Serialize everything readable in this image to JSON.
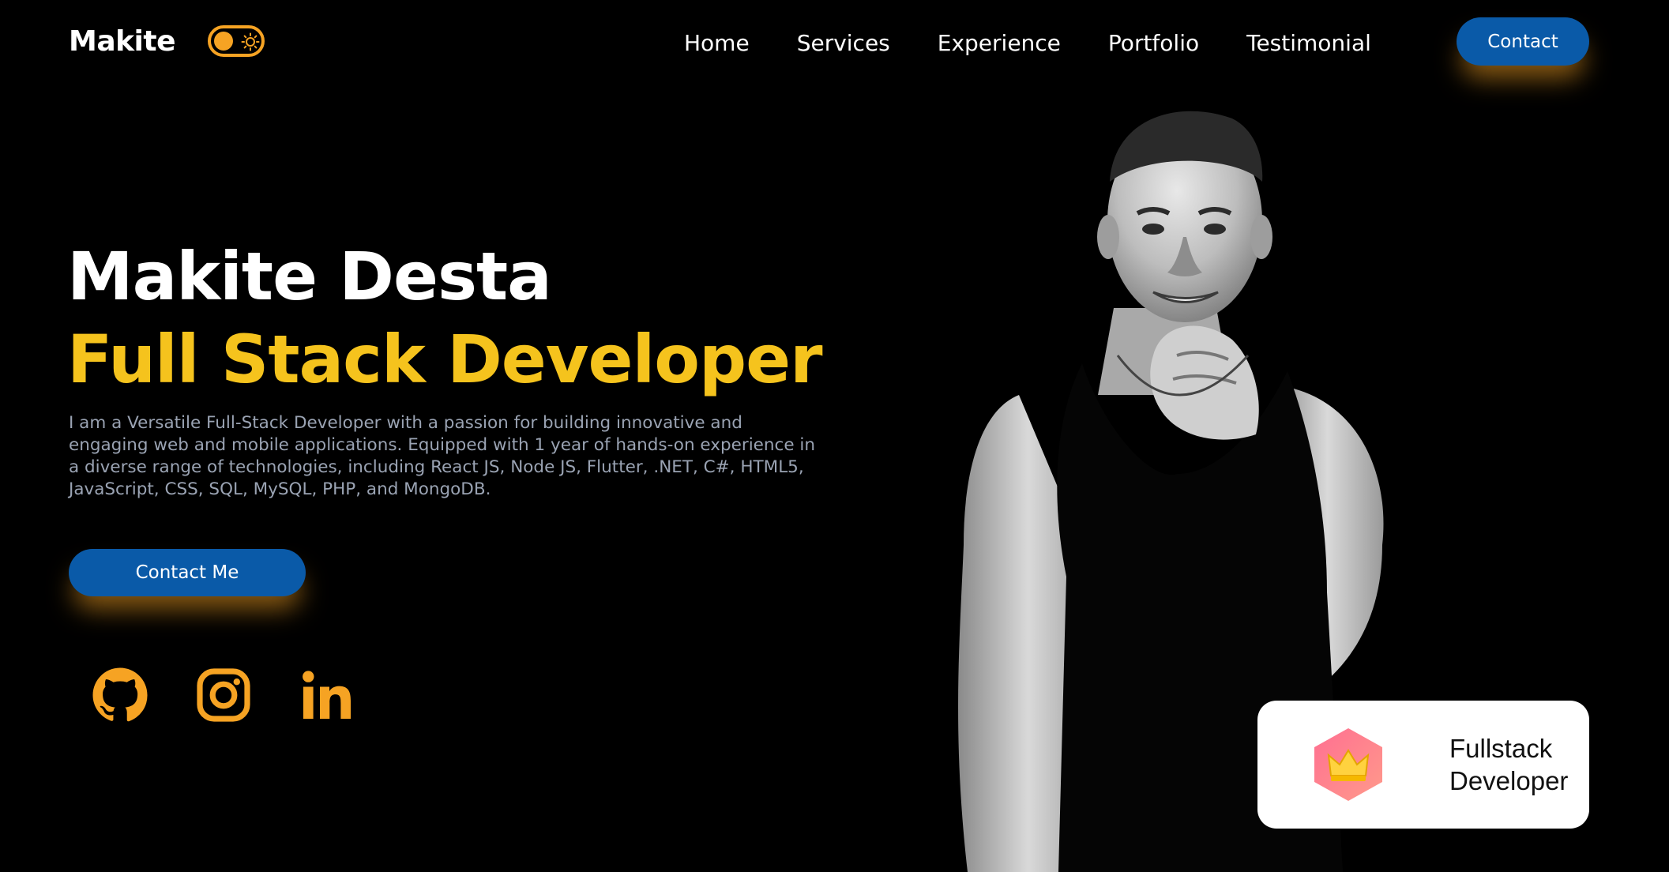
{
  "brand": {
    "logo_text": "Makite"
  },
  "theme_toggle": {
    "state": "dark",
    "accent_color": "#f6a323"
  },
  "nav": {
    "links": [
      "Home",
      "Services",
      "Experience",
      "Portfolio",
      "Testimonial"
    ],
    "contact_label": "Contact"
  },
  "hero": {
    "name": "Makite Desta",
    "role": "Full Stack Developer",
    "description": "I am a Versatile Full-Stack Developer with a passion for building innovative and engaging web and mobile applications. Equipped with 1 year of hands-on experience in a diverse range of technologies, including React JS, Node JS, Flutter, .NET, C#, HTML5, JavaScript, CSS, SQL, MySQL, PHP, and MongoDB.",
    "cta_label": "Contact Me"
  },
  "socials": [
    {
      "icon": "github-icon"
    },
    {
      "icon": "instagram-icon"
    },
    {
      "icon": "linkedin-icon"
    }
  ],
  "badge": {
    "icon": "crown-icon",
    "text": "Fullstack Developer"
  },
  "colors": {
    "background": "#000000",
    "accent_yellow": "#f5c31d",
    "accent_orange": "#f6a323",
    "button_blue": "#0a5aa8",
    "body_text": "#9aa3b3"
  }
}
